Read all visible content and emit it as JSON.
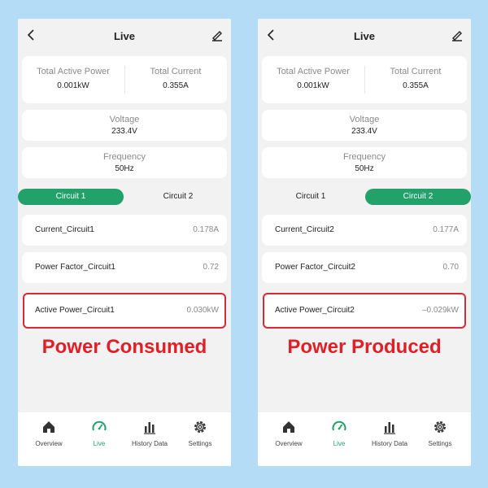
{
  "colors": {
    "accent": "#22a16b",
    "highlight": "#d6293a",
    "caption": "#e01f26",
    "background": "#b5dcf6"
  },
  "left": {
    "title": "Live",
    "total_active_power_label": "Total Active Power",
    "total_active_power_value": "0.001kW",
    "total_current_label": "Total Current",
    "total_current_value": "0.355A",
    "voltage_label": "Voltage",
    "voltage_value": "233.4V",
    "frequency_label": "Frequency",
    "frequency_value": "50Hz",
    "tabs": [
      {
        "label": "Circuit 1",
        "active": true
      },
      {
        "label": "Circuit 2",
        "active": false
      }
    ],
    "rows": [
      {
        "label": "Current_Circuit1",
        "value": "0.178A"
      },
      {
        "label": "Power Factor_Circuit1",
        "value": "0.72"
      },
      {
        "label": "Active Power_Circuit1",
        "value": "0.030kW"
      }
    ],
    "caption": "Power Consumed",
    "nav": [
      {
        "label": "Overview",
        "icon": "home-icon"
      },
      {
        "label": "Live",
        "icon": "gauge-icon",
        "active": true
      },
      {
        "label": "History Data",
        "icon": "bar-chart-icon"
      },
      {
        "label": "Settings",
        "icon": "gear-icon"
      }
    ]
  },
  "right": {
    "title": "Live",
    "total_active_power_label": "Total Active Power",
    "total_active_power_value": "0.001kW",
    "total_current_label": "Total Current",
    "total_current_value": "0.355A",
    "voltage_label": "Voltage",
    "voltage_value": "233.4V",
    "frequency_label": "Frequency",
    "frequency_value": "50Hz",
    "tabs": [
      {
        "label": "Circuit 1",
        "active": false
      },
      {
        "label": "Circuit 2",
        "active": true
      }
    ],
    "rows": [
      {
        "label": "Current_Circuit2",
        "value": "0.177A"
      },
      {
        "label": "Power Factor_Circuit2",
        "value": "0.70"
      },
      {
        "label": "Active Power_Circuit2",
        "value": "–0.029kW"
      }
    ],
    "caption": "Power Produced",
    "nav": [
      {
        "label": "Overview",
        "icon": "home-icon"
      },
      {
        "label": "Live",
        "icon": "gauge-icon",
        "active": true
      },
      {
        "label": "History Data",
        "icon": "bar-chart-icon"
      },
      {
        "label": "Settings",
        "icon": "gear-icon"
      }
    ]
  }
}
